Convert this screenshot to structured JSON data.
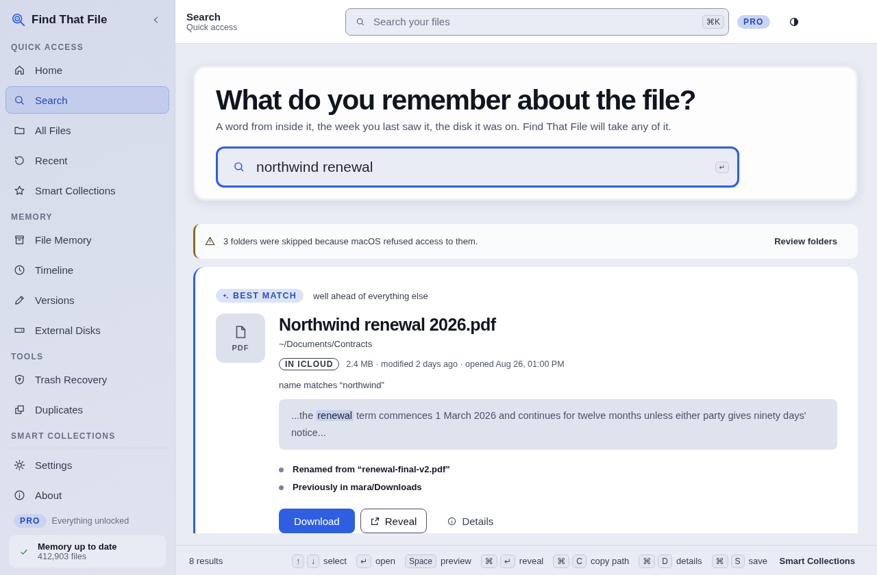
{
  "sidebar": {
    "app_name": "Find That File",
    "sections": [
      {
        "heading": "QUICK ACCESS",
        "items": [
          {
            "label": "Home",
            "selected": false
          },
          {
            "label": "Search",
            "selected": true
          },
          {
            "label": "All Files",
            "selected": false
          },
          {
            "label": "Recent",
            "selected": false
          },
          {
            "label": "Smart Collections",
            "selected": false
          }
        ]
      },
      {
        "heading": "MEMORY",
        "items": [
          {
            "label": "File Memory",
            "selected": false
          },
          {
            "label": "Timeline",
            "selected": false
          },
          {
            "label": "Versions",
            "selected": false
          },
          {
            "label": "External Disks",
            "selected": false
          }
        ]
      },
      {
        "heading": "TOOLS",
        "items": [
          {
            "label": "Trash Recovery",
            "selected": false
          },
          {
            "label": "Duplicates",
            "selected": false
          }
        ]
      },
      {
        "heading": "SMART COLLECTIONS"
      }
    ],
    "bottom_items": [
      {
        "label": "Settings",
        "selected": false
      },
      {
        "label": "About",
        "selected": false
      }
    ],
    "plan": {
      "badge": "PRO",
      "note": "Everything unlocked"
    },
    "status": {
      "title": "Memory up to date",
      "subtitle": "412,903 files"
    }
  },
  "header": {
    "title": "Search",
    "subtitle": "Quick access",
    "search": {
      "placeholder": "Search your files",
      "shortcut": "⌘K"
    },
    "badge": "PRO"
  },
  "hero": {
    "heading": "What do you remember about the file?",
    "text": "A word from inside it, the week you last saw it, the disk it was on. Find That File will take any of it.",
    "query": "northwind renewal",
    "enter_key": "↵"
  },
  "alert": {
    "text": "3 folders were skipped because macOS refused access to them.",
    "action": "Review folders"
  },
  "result": {
    "badge": "BEST MATCH",
    "badge_note": "well ahead of everything else",
    "file_type": "PDF",
    "name": "Northwind renewal 2026.pdf",
    "path": "~/Documents/Contracts",
    "location_tag": "IN ICLOUD",
    "meta": "2.4 MB · modified 2 days ago · opened Aug 26, 01:00 PM",
    "match_reason": "name matches “northwind”",
    "snippet": {
      "before": "...the ",
      "highlight": "renewal",
      "after": " term commences 1 March 2026 and continues for twelve months unless either party gives ninety days' notice..."
    },
    "history": [
      "Renamed from “renewal-final-v2.pdf”",
      "Previously in mara/Downloads"
    ],
    "actions": [
      {
        "label": "Download",
        "kind": "primary"
      },
      {
        "label": "Reveal",
        "kind": "secondary"
      },
      {
        "label": "Details",
        "kind": "link"
      }
    ]
  },
  "footer": {
    "count": "8 results",
    "shortcuts": [
      {
        "keys": [
          "↑",
          "↓"
        ],
        "label": "select"
      },
      {
        "keys": [
          "↵"
        ],
        "label": "open"
      },
      {
        "keys": [
          "Space"
        ],
        "label": "preview"
      },
      {
        "keys": [
          "⌘",
          "↵"
        ],
        "label": "reveal"
      },
      {
        "keys": [
          "⌘",
          "C"
        ],
        "label": "copy path"
      },
      {
        "keys": [
          "⌘",
          "D"
        ],
        "label": "details"
      },
      {
        "keys": [
          "⌘",
          "S"
        ],
        "label": "save"
      }
    ],
    "link": "Smart Collections"
  }
}
